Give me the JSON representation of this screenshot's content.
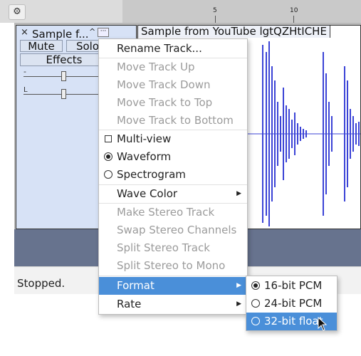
{
  "ruler": {
    "ticks": [
      "5",
      "10"
    ]
  },
  "track": {
    "name": "Sample f...",
    "collapse_symbol": "^",
    "close_symbol": "×",
    "menu_symbol": "···",
    "mute_label": "Mute",
    "solo_label": "Solo",
    "effects_label": "Effects",
    "gain_left_label": "-",
    "pan_left_label": "L"
  },
  "waveform": {
    "title": "Sample from YouTube lgtQZHtICHE",
    "color": "#3b43d6"
  },
  "status": {
    "text": "Stopped."
  },
  "context_menu": {
    "items": [
      {
        "label": "Rename Track...",
        "enabled": true
      },
      {
        "label": "Move Track Up",
        "enabled": false
      },
      {
        "label": "Move Track Down",
        "enabled": false
      },
      {
        "label": "Move Track to Top",
        "enabled": false
      },
      {
        "label": "Move Track to Bottom",
        "enabled": false
      },
      {
        "label": "Multi-view",
        "enabled": true,
        "control": "checkbox",
        "checked": false
      },
      {
        "label": "Waveform",
        "enabled": true,
        "control": "radio",
        "checked": true
      },
      {
        "label": "Spectrogram",
        "enabled": true,
        "control": "radio",
        "checked": false
      },
      {
        "label": "Wave Color",
        "enabled": true,
        "submenu": true
      },
      {
        "label": "Make Stereo Track",
        "enabled": false
      },
      {
        "label": "Swap Stereo Channels",
        "enabled": false
      },
      {
        "label": "Split Stereo Track",
        "enabled": false
      },
      {
        "label": "Split Stereo to Mono",
        "enabled": false
      },
      {
        "label": "Format",
        "enabled": true,
        "submenu": true,
        "highlighted": true
      },
      {
        "label": "Rate",
        "enabled": true,
        "submenu": true
      }
    ]
  },
  "format_submenu": {
    "items": [
      {
        "label": "16-bit PCM",
        "checked": true,
        "highlighted": false
      },
      {
        "label": "24-bit PCM",
        "checked": false,
        "highlighted": false
      },
      {
        "label": "32-bit float",
        "checked": false,
        "highlighted": true
      }
    ]
  },
  "colors": {
    "highlight": "#4a8fd9",
    "track_bg": "#d7e2f6",
    "lower_band": "#67738e"
  }
}
